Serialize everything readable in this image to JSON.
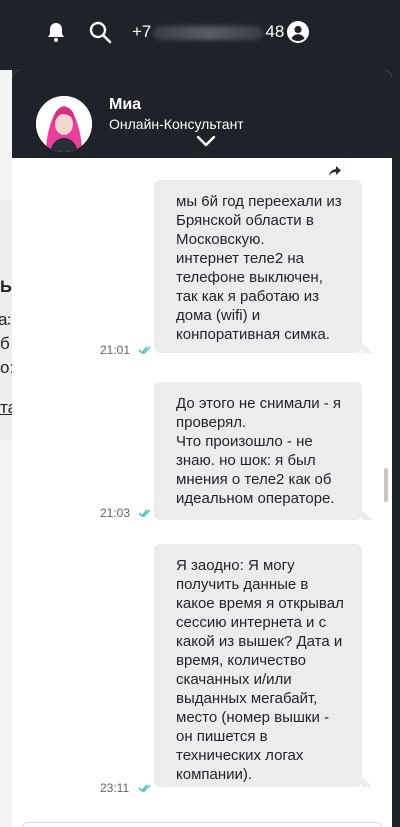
{
  "topbar": {
    "phone_prefix": "+7",
    "phone_suffix": "48",
    "icons": [
      "bell-icon",
      "search-icon",
      "user-account-icon"
    ]
  },
  "background_page": {
    "fragments": [
      "Ы",
      "аз",
      "б",
      "о:",
      "та"
    ]
  },
  "chat": {
    "agent_name": "Миа",
    "agent_role": "Онлайн-Консультант",
    "messages": [
      {
        "text": "мы 6й год переехали из Брянской области в Московскую.\nинтернет теле2 на телефоне выключен, так как я работаю из дома (wifi) и конпоративная симка.",
        "time": "21:01"
      },
      {
        "text": "До этого не снимали - я проверял.\nЧто произошло - не знаю. но шок: я был мнения о теле2 как об идеальном операторе.",
        "time": "21:03"
      },
      {
        "text": "Я заодно: Я могу получить данные в какое время я открывал сессию интернета и с какой из вышек? Дата и время, количество скачанных и/или выданных мегабайт, место (номер вышки - он пишется в технических логах компании).",
        "time": "23:11"
      }
    ]
  },
  "colors": {
    "header_bg": "#1f2229",
    "bubble_bg": "#ececec",
    "check_color": "#3fb8c8",
    "accent_pink": "#e8409a"
  }
}
